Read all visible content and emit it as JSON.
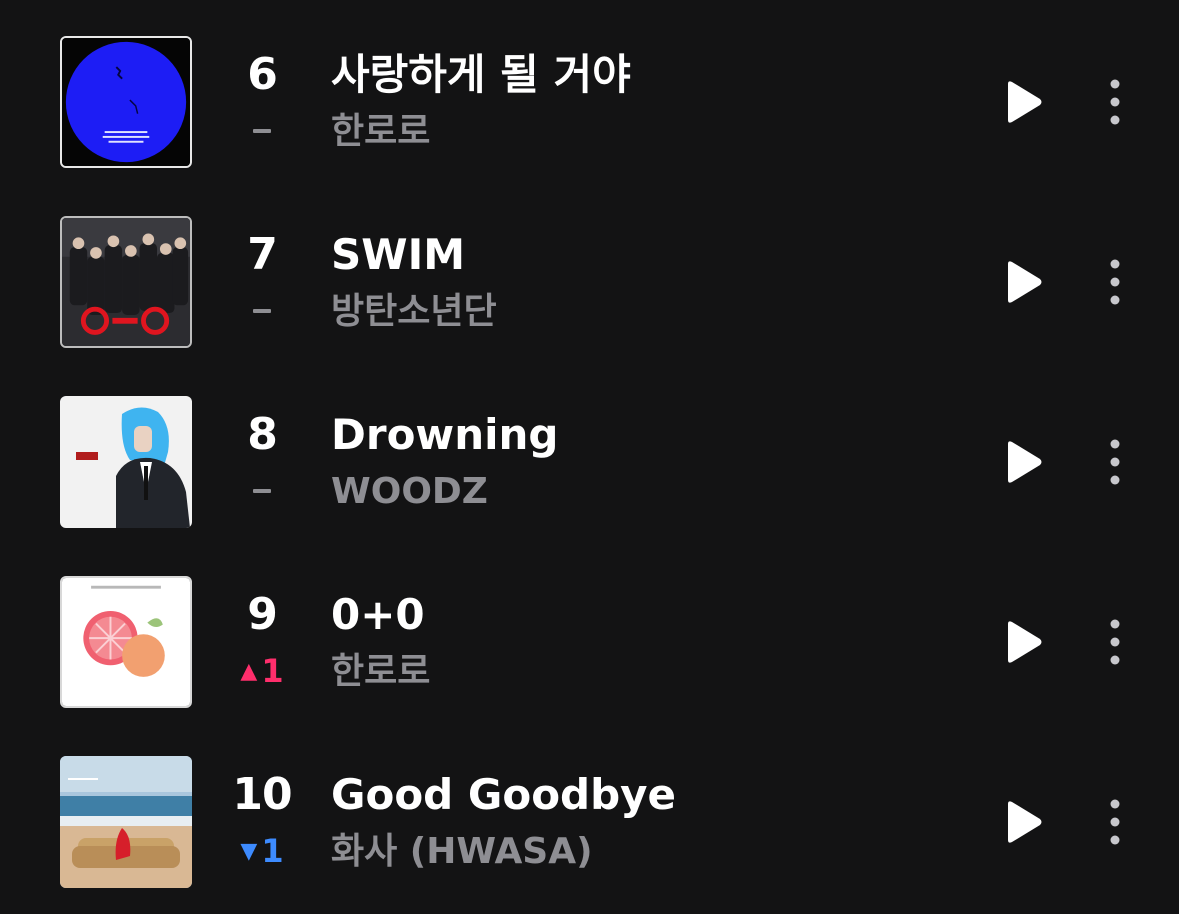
{
  "tracks": [
    {
      "rank": "6",
      "change": "none",
      "change_value": "",
      "title": "사랑하게 될 거야",
      "artist": "한로로",
      "cover_icon": "blue-moon-cover"
    },
    {
      "rank": "7",
      "change": "none",
      "change_value": "",
      "title": "SWIM",
      "artist": "방탄소년단",
      "cover_icon": "group-photo-cover"
    },
    {
      "rank": "8",
      "change": "none",
      "change_value": "",
      "title": "Drowning",
      "artist": "WOODZ",
      "cover_icon": "blue-hair-portrait-cover"
    },
    {
      "rank": "9",
      "change": "up",
      "change_value": "1",
      "title": "0+0",
      "artist": "한로로",
      "cover_icon": "grapefruit-painting-cover"
    },
    {
      "rank": "10",
      "change": "down",
      "change_value": "1",
      "title": "Good Goodbye",
      "artist": "화사 (HWASA)",
      "cover_icon": "beach-sofa-cover"
    }
  ],
  "colors": {
    "background": "#131314",
    "text_primary": "#ffffff",
    "text_secondary": "#8e8e93",
    "rank_up": "#ff2e6c",
    "rank_down": "#3d8bff"
  },
  "icons": {
    "play": "play-icon",
    "more": "more-vertical-icon",
    "up_arrow": "triangle-up-icon",
    "down_arrow": "triangle-down-icon"
  }
}
